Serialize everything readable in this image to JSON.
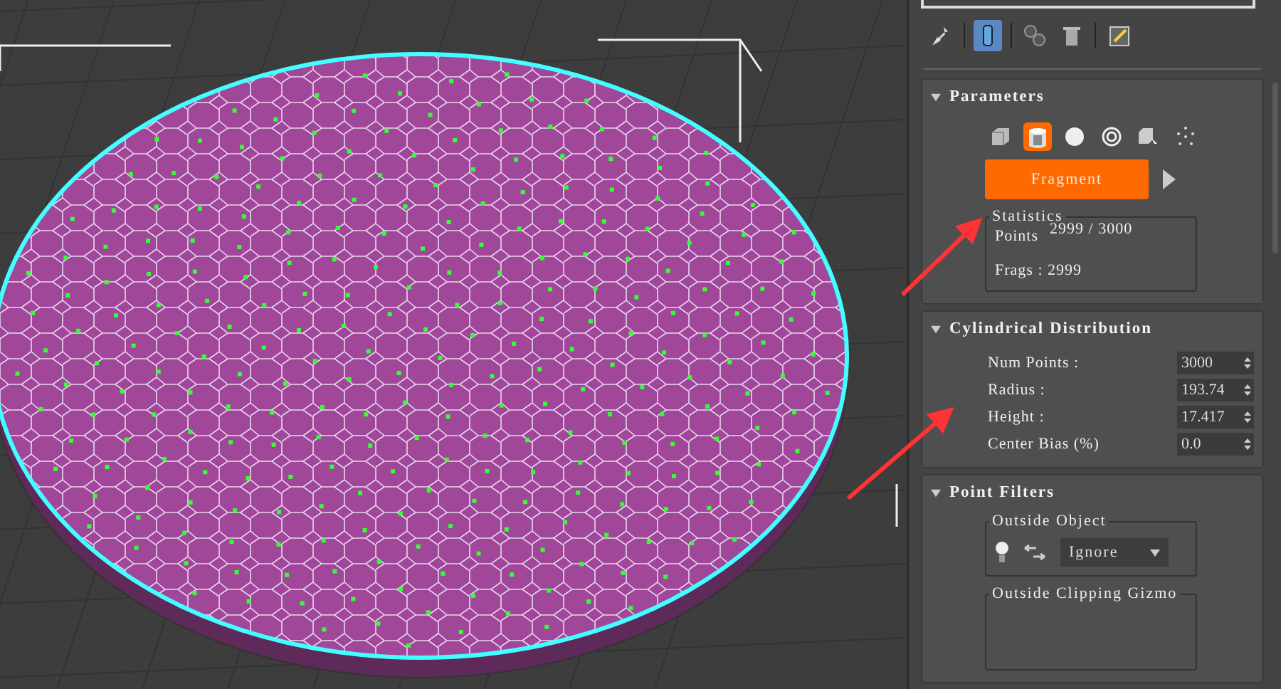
{
  "toolbar": [
    {
      "kind": "pin",
      "selected": false
    },
    {
      "kind": "tube",
      "selected": true
    },
    {
      "kind": "instances",
      "selected": false
    },
    {
      "kind": "trash",
      "selected": false
    },
    {
      "kind": "configure",
      "selected": false
    }
  ],
  "rollouts": [
    {
      "kind": "parameters",
      "title": "Parameters",
      "expanded": true,
      "shapes": [
        {
          "kind": "box",
          "selected": false
        },
        {
          "kind": "cylinder",
          "selected": true
        },
        {
          "kind": "sphere",
          "selected": false
        },
        {
          "kind": "rings",
          "selected": false
        },
        {
          "kind": "object",
          "selected": false
        },
        {
          "kind": "points",
          "selected": false
        }
      ],
      "action": "Fragment",
      "statistics": {
        "title": "Statistics",
        "points_label": "Points",
        "points_value": "2999 / 3000",
        "frags": "Frags : 2999"
      }
    },
    {
      "kind": "distribution",
      "title": "Cylindrical Distribution",
      "expanded": true,
      "fields": [
        {
          "label": "Num Points :",
          "value": "3000"
        },
        {
          "label": "Radius :",
          "value": "193.74"
        },
        {
          "label": "Height :",
          "value": "17.417"
        },
        {
          "label": "Center Bias (%)",
          "value": "0.0"
        }
      ]
    },
    {
      "kind": "filters",
      "title": "Point Filters",
      "expanded": true,
      "groups": [
        {
          "title": "Outside Object",
          "option": "Ignore"
        },
        {
          "title": "Outside Clipping Gizmo"
        }
      ]
    }
  ]
}
